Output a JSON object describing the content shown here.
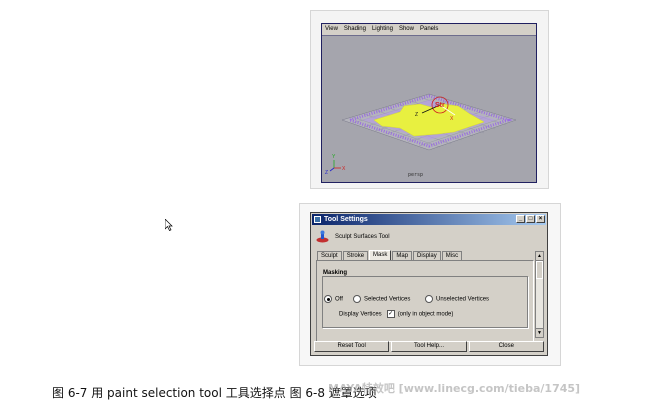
{
  "viewport": {
    "menu": [
      "View",
      "Shading",
      "Lighting",
      "Show",
      "Panels"
    ],
    "camera_label": "persp",
    "axis_labels": {
      "x": "X",
      "y": "Y",
      "z": "Z"
    },
    "manip_label": "Str"
  },
  "tool_settings": {
    "title": "Tool Settings",
    "tool_name": "Sculpt Surfaces Tool",
    "tabs": [
      "Sculpt",
      "Stroke",
      "Mask",
      "Map",
      "Display",
      "Misc"
    ],
    "active_tab": "Mask",
    "group_label": "Masking",
    "radios": {
      "off": "Off",
      "selected": "Selected Vertices",
      "unselected": "Unselected Vertices"
    },
    "selected_radio": "Off",
    "display_vertices_label": "Display Vertices",
    "display_vertices_checked": true,
    "only_object_mode_label": "(only in object mode)",
    "buttons": {
      "reset": "Reset Tool",
      "help": "Tool Help...",
      "close": "Close"
    }
  },
  "caption": "图 6-7 用 paint selection tool 工具选择点 图 6-8 遮罩选项",
  "watermark": "MAYA特效吧 [www.linecg.com/tieba/1745]",
  "colors": {
    "viewport_bg": "#a5a5ad",
    "mesh_yellow": "#e8f040",
    "mesh_purple": "#9a6ee0",
    "title_gradient_start": "#0a246a",
    "title_gradient_end": "#a6caf0"
  }
}
